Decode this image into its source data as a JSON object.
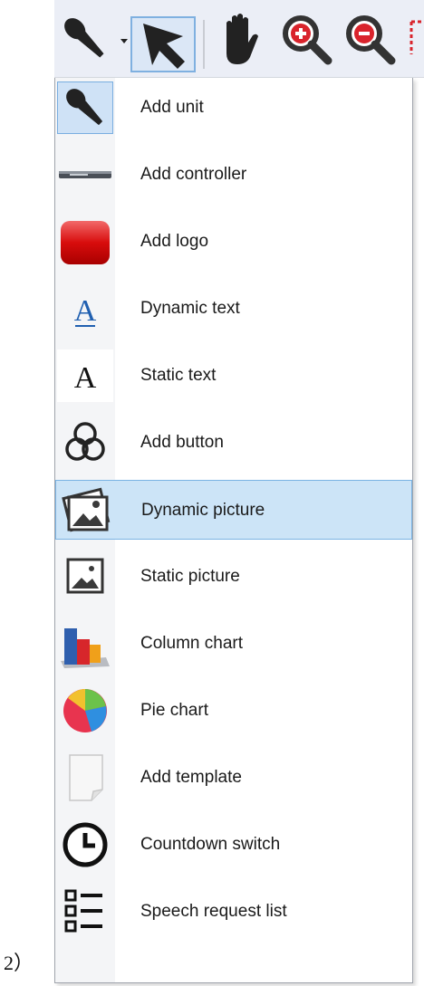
{
  "toolbar": {
    "buttons": [
      {
        "name": "unit-tool",
        "icon": "microphone-icon"
      },
      {
        "name": "dropdown",
        "icon": "dropdown-arrow-icon"
      },
      {
        "name": "select-tool",
        "icon": "pointer-arrow-icon"
      },
      {
        "name": "pan-tool",
        "icon": "hand-icon"
      },
      {
        "name": "zoom-in",
        "icon": "zoom-in-icon"
      },
      {
        "name": "zoom-out",
        "icon": "zoom-out-icon"
      },
      {
        "name": "rect-select",
        "icon": "dashed-rect-icon"
      }
    ]
  },
  "menu": {
    "items": [
      {
        "label": "Add unit",
        "icon": "microphone-icon"
      },
      {
        "label": "Add controller",
        "icon": "controller-icon"
      },
      {
        "label": "Add logo",
        "icon": "red-logo-icon"
      },
      {
        "label": "Dynamic text",
        "icon": "underlined-a-icon"
      },
      {
        "label": "Static text",
        "icon": "letter-a-icon"
      },
      {
        "label": "Add button",
        "icon": "three-circles-icon"
      },
      {
        "label": "Dynamic picture",
        "icon": "stacked-pictures-icon"
      },
      {
        "label": "Static picture",
        "icon": "picture-icon"
      },
      {
        "label": "Column chart",
        "icon": "column-chart-icon"
      },
      {
        "label": "Pie chart",
        "icon": "pie-chart-icon"
      },
      {
        "label": "Add template",
        "icon": "page-icon"
      },
      {
        "label": "Countdown switch",
        "icon": "clock-icon"
      },
      {
        "label": "Speech request list",
        "icon": "checklist-icon"
      }
    ],
    "highlighted": "Dynamic picture"
  },
  "step_label": "2）",
  "colors": {
    "toolbar_bg": "#ebeef6",
    "highlight_bg": "#cce4f7",
    "highlight_border": "#7ab3e3",
    "zoom_red": "#d9242c",
    "logo_red": "#d80c0c"
  }
}
